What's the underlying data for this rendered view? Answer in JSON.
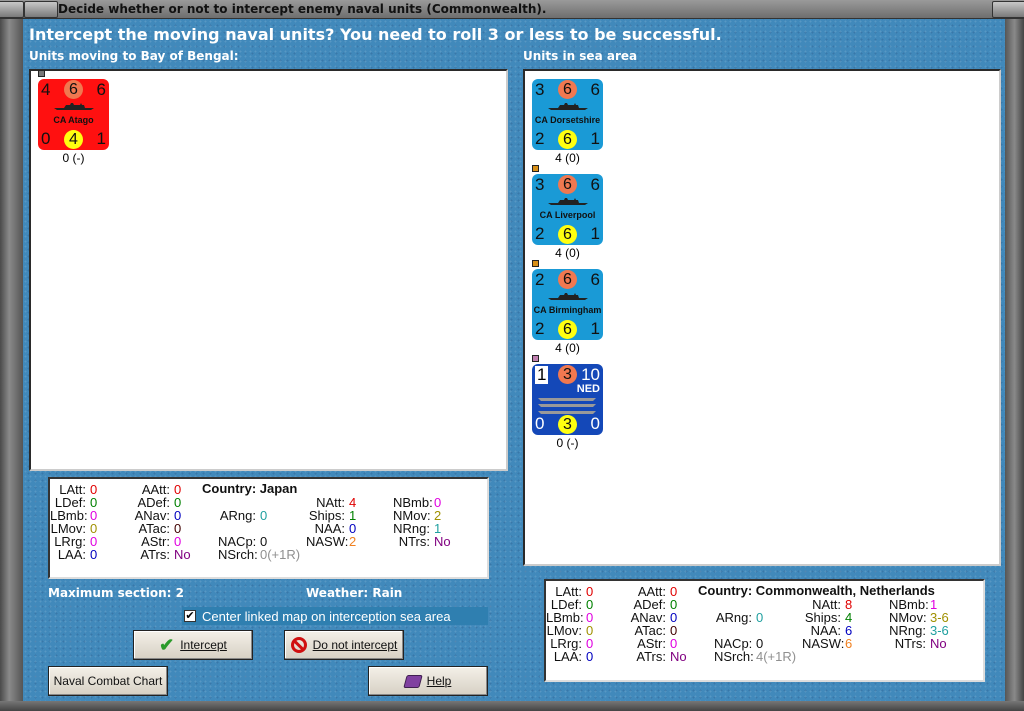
{
  "window": {
    "title": "Decide whether or not to intercept enemy naval units (Commonwealth)."
  },
  "header": {
    "question": "Intercept the moving naval units?  You need to roll 3 or less to be successful."
  },
  "left": {
    "heading": "Units moving to Bay of Bengal:"
  },
  "right": {
    "heading": "Units in sea area"
  },
  "moving_units": [
    {
      "name": "CA Atago",
      "tl": "4",
      "tc": "6",
      "tr": "6",
      "bl": "0",
      "bc": "4",
      "br": "1",
      "label": "0 (-)",
      "color": "#ff1010",
      "marker": "#777777"
    }
  ],
  "sea_units": [
    {
      "name": "CA Dorsetshire",
      "tl": "3",
      "tc": "6",
      "tr": "6",
      "bl": "2",
      "bc": "6",
      "br": "1",
      "label": "4 (0)",
      "color": "#1a9ad6",
      "marker": null
    },
    {
      "name": "CA Liverpool",
      "tl": "3",
      "tc": "6",
      "tr": "6",
      "bl": "2",
      "bc": "6",
      "br": "1",
      "label": "4 (0)",
      "color": "#1a9ad6",
      "marker": "#d89018"
    },
    {
      "name": "CA Birmingham",
      "tl": "2",
      "tc": "6",
      "tr": "6",
      "bl": "2",
      "bc": "6",
      "br": "1",
      "label": "4 (0)",
      "color": "#1a9ad6",
      "marker": "#d89018"
    },
    {
      "name": "",
      "nation": "NED",
      "tl": "1",
      "tc": "3",
      "tr": "10",
      "bl": "0",
      "bc": "3",
      "br": "0",
      "label": "0 (-)",
      "color": "#1448b8",
      "marker": "#c080b0"
    }
  ],
  "left_stats": {
    "country": "Country: Japan",
    "rows": [
      [
        [
          "LAtt:",
          "0",
          "#e00000"
        ],
        [
          "AAtt:",
          "0",
          "#e00000"
        ],
        null,
        null,
        null
      ],
      [
        [
          "LDef:",
          "0",
          "#008000"
        ],
        [
          "ADef:",
          "0",
          "#008000"
        ],
        null,
        [
          "NAtt:",
          "4",
          "#e00000"
        ],
        [
          "NBmb:",
          "0",
          "#e000e0"
        ]
      ],
      [
        [
          "LBmb:",
          "0",
          "#e000e0"
        ],
        [
          "ANav:",
          "0",
          "#0000c0"
        ],
        [
          "ARng:",
          "0",
          "#20a0a0"
        ],
        [
          "Ships:",
          "1",
          "#008000"
        ],
        [
          "NMov:",
          "2",
          "#a09000"
        ]
      ],
      [
        [
          "LMov:",
          "0",
          "#a09000"
        ],
        [
          "ATac:",
          "0",
          "#400000"
        ],
        null,
        [
          "NAA:",
          "0",
          "#0000c0"
        ],
        [
          "NRng:",
          "1",
          "#20a0a0"
        ]
      ],
      [
        [
          "LRrg:",
          "0",
          "#e000e0"
        ],
        [
          "AStr:",
          "0",
          "#e000e0"
        ],
        [
          "NACp:",
          "0",
          "#111111"
        ],
        [
          "NASW:",
          "2",
          "#f08020"
        ],
        [
          "NTrs:",
          "No",
          "#800080"
        ]
      ],
      [
        [
          "LAA:",
          "0",
          "#0000c0"
        ],
        [
          "ATrs:",
          "No",
          "#800080"
        ],
        [
          "NSrch:",
          "0(+1R)",
          "#909090"
        ],
        null,
        null
      ]
    ]
  },
  "right_stats": {
    "country": "Country: Commonwealth, Netherlands",
    "rows": [
      [
        [
          "LAtt:",
          "0",
          "#e00000"
        ],
        [
          "AAtt:",
          "0",
          "#e00000"
        ],
        null,
        null,
        null
      ],
      [
        [
          "LDef:",
          "0",
          "#008000"
        ],
        [
          "ADef:",
          "0",
          "#008000"
        ],
        null,
        [
          "NAtt:",
          "8",
          "#e00000"
        ],
        [
          "NBmb:",
          "1",
          "#e000e0"
        ]
      ],
      [
        [
          "LBmb:",
          "0",
          "#e000e0"
        ],
        [
          "ANav:",
          "0",
          "#0000c0"
        ],
        [
          "ARng:",
          "0",
          "#20a0a0"
        ],
        [
          "Ships:",
          "4",
          "#008000"
        ],
        [
          "NMov:",
          "3-6",
          "#a09000"
        ]
      ],
      [
        [
          "LMov:",
          "0",
          "#a09000"
        ],
        [
          "ATac:",
          "0",
          "#400000"
        ],
        null,
        [
          "NAA:",
          "6",
          "#0000c0"
        ],
        [
          "NRng:",
          "3-6",
          "#20a0a0"
        ]
      ],
      [
        [
          "LRrg:",
          "0",
          "#e000e0"
        ],
        [
          "AStr:",
          "0",
          "#e000e0"
        ],
        [
          "NACp:",
          "0",
          "#111111"
        ],
        [
          "NASW:",
          "6",
          "#f08020"
        ],
        [
          "NTrs:",
          "No",
          "#800080"
        ]
      ],
      [
        [
          "LAA:",
          "0",
          "#0000c0"
        ],
        [
          "ATrs:",
          "No",
          "#800080"
        ],
        [
          "NSrch:",
          "4(+1R)",
          "#909090"
        ],
        null,
        null
      ]
    ]
  },
  "info": {
    "max_section": "Maximum section: 2",
    "weather": "Weather:  Rain"
  },
  "checkbox": {
    "label": "Center linked map on interception sea area",
    "checked": true
  },
  "buttons": {
    "intercept": "Intercept",
    "do_not_intercept": "Do not intercept",
    "naval_combat_chart": "Naval Combat Chart",
    "help": "Help"
  }
}
